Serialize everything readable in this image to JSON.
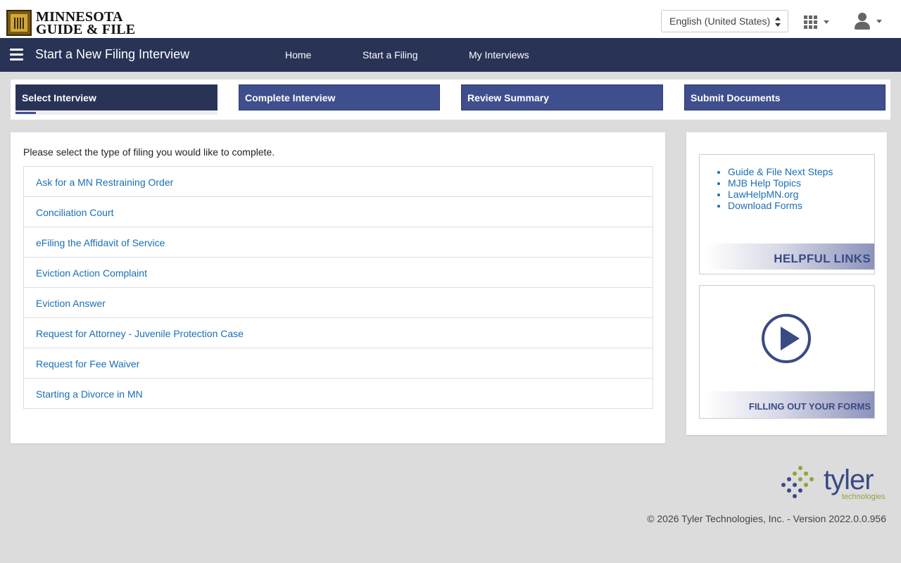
{
  "header": {
    "logo_line1": "MINNESOTA",
    "logo_line2": "GUIDE & FILE",
    "language_selected": "English (United States)",
    "apps_icon": "grid-icon",
    "user_icon": "user-icon"
  },
  "nav": {
    "title": "Start a New Filing Interview",
    "links": [
      "Home",
      "Start a Filing",
      "My Interviews"
    ]
  },
  "stepper": {
    "steps": [
      "Select Interview",
      "Complete Interview",
      "Review Summary",
      "Submit Documents"
    ],
    "active_step": "Select Interview",
    "progress_fraction": 0.1
  },
  "main": {
    "instructions": "Please select the type of filing you would like to complete.",
    "interviews": [
      "Ask for a MN Restraining Order",
      "Conciliation Court",
      "eFiling the Affidavit of Service",
      "Eviction Action Complaint",
      "Eviction Answer",
      "Request for Attorney - Juvenile Protection Case",
      "Request for Fee Waiver",
      "Starting a Divorce in MN"
    ]
  },
  "side": {
    "links": [
      "Guide & File Next Steps",
      "MJB Help Topics",
      "LawHelpMN.org",
      "Download Forms"
    ],
    "helpful_links_label": "HELPFUL LINKS",
    "video_label": "FILLING OUT YOUR FORMS",
    "video_icon": "play-icon"
  },
  "footer": {
    "brand": "tyler",
    "brand_sub": "technologies",
    "copyright": "© 2026 Tyler Technologies, Inc. - Version 2022.0.0.956"
  },
  "colors": {
    "navbar": "#283356",
    "step": "#3f4f8d",
    "link": "#1a6fb5",
    "background": "#dcdcdc"
  }
}
